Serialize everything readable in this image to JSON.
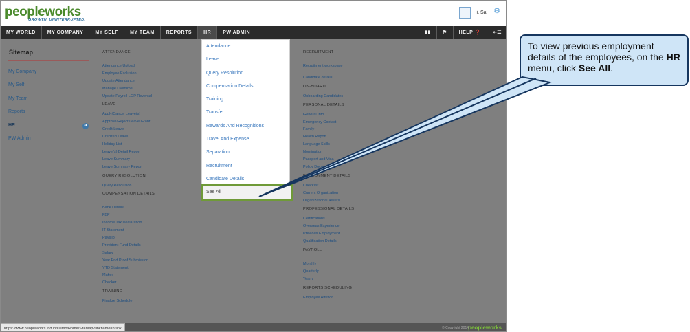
{
  "header": {
    "logo": "peopleworks",
    "tagline": "GROWTH. UNINTERRUPTED.",
    "greeting": "Hi, Sai",
    "settings_icon": "gear-icon"
  },
  "nav": {
    "items": [
      "MY WORLD",
      "MY COMPANY",
      "MY SELF",
      "MY TEAM",
      "REPORTS",
      "HR",
      "PW ADMIN"
    ],
    "active": "HR",
    "help": "HELP"
  },
  "sidebar": {
    "title": "Sitemap",
    "items": [
      "My Company",
      "My Self",
      "My Team",
      "Reports",
      "HR",
      "PW Admin"
    ]
  },
  "sitemap_col1": [
    {
      "t": "ATTENDANCE",
      "h": true
    },
    {
      "t": "",
      "g": true
    },
    {
      "t": "Attendance Upload"
    },
    {
      "t": "Employee Exclusion"
    },
    {
      "t": "Update Attendance"
    },
    {
      "t": "Manage Overtime"
    },
    {
      "t": "Update Payroll-LOP Reversal"
    },
    {
      "t": "LEAVE",
      "h": true
    },
    {
      "t": "Apply/Cancel Leave(s)"
    },
    {
      "t": "Approve/Reject Leave Grant"
    },
    {
      "t": "Credit Leave"
    },
    {
      "t": "Credited Leave"
    },
    {
      "t": "Holiday List"
    },
    {
      "t": "Leave(s) Detail Report"
    },
    {
      "t": "Leave Summary"
    },
    {
      "t": "Leave Summary Report"
    },
    {
      "t": "QUERY RESOLUTION",
      "h": true
    },
    {
      "t": "Query Resolution"
    },
    {
      "t": "COMPENSATION DETAILS",
      "h": true
    },
    {
      "t": "",
      "g": true
    },
    {
      "t": "Bank Details"
    },
    {
      "t": "FBP"
    },
    {
      "t": "Income Tax Declaration"
    },
    {
      "t": "IT Statement"
    },
    {
      "t": "Payslip"
    },
    {
      "t": "Provident Fund Details"
    },
    {
      "t": "Salary"
    },
    {
      "t": "Year End Proof Submission"
    },
    {
      "t": "YTD Statement"
    },
    {
      "t": "Maker"
    },
    {
      "t": "Checker"
    },
    {
      "t": "TRAINING",
      "h": true
    },
    {
      "t": "Finalize Schedule"
    }
  ],
  "sitemap_col3": [
    {
      "t": "RECRUITMENT",
      "h": true
    },
    {
      "t": "",
      "g": true
    },
    {
      "t": "Recruitment workspace"
    },
    {
      "t": "",
      "g": true
    },
    {
      "t": "Candidate details"
    },
    {
      "t": "ON-BOARD",
      "h": true
    },
    {
      "t": "Onboarding Candidates"
    },
    {
      "t": "PERSONAL DETAILS",
      "h": true
    },
    {
      "t": "General Info"
    },
    {
      "t": "Emergency Contact"
    },
    {
      "t": "Family"
    },
    {
      "t": "Health Report"
    },
    {
      "t": "Language Skills"
    },
    {
      "t": "Nomination"
    },
    {
      "t": "Passport and Visa"
    },
    {
      "t": "Policy Document"
    },
    {
      "t": "EMPLOYMENT DETAILS",
      "h": true
    },
    {
      "t": "Checklist"
    },
    {
      "t": "Current Organization"
    },
    {
      "t": "Organizational Assets"
    },
    {
      "t": "PROFESSIONAL DETAILS",
      "h": true
    },
    {
      "t": "Certifications"
    },
    {
      "t": "Overseas Experience"
    },
    {
      "t": "Previous Employment"
    },
    {
      "t": "Qualification Details"
    },
    {
      "t": "PAYROLL",
      "h": true
    },
    {
      "t": "",
      "g": true
    },
    {
      "t": "Monthly"
    },
    {
      "t": "Quarterly"
    },
    {
      "t": "Yearly"
    },
    {
      "t": "REPORTS SCHEDULING",
      "h": true
    },
    {
      "t": "Employee Attrition"
    }
  ],
  "hr_menu": {
    "items": [
      "Attendance",
      "Leave",
      "Query Resolution",
      "Compensation Details",
      "Training",
      "Transfer",
      "Rewards And Recognitions",
      "Travel And Expense",
      "Separation",
      "Recruitment",
      "Candidate Details"
    ],
    "see_all": "See All"
  },
  "status": {
    "url": "https://www.peopleworks.ind.in/Demo/Home/SiteMap?linkname=hrlink",
    "copyright": "© Copyright 2014",
    "footer_logo": "peopleworks"
  },
  "callout": {
    "before": "To view previous employment details of the employees,  on the ",
    "menu": "HR",
    "middle": " menu, click ",
    "target": "See All",
    "after": "."
  }
}
